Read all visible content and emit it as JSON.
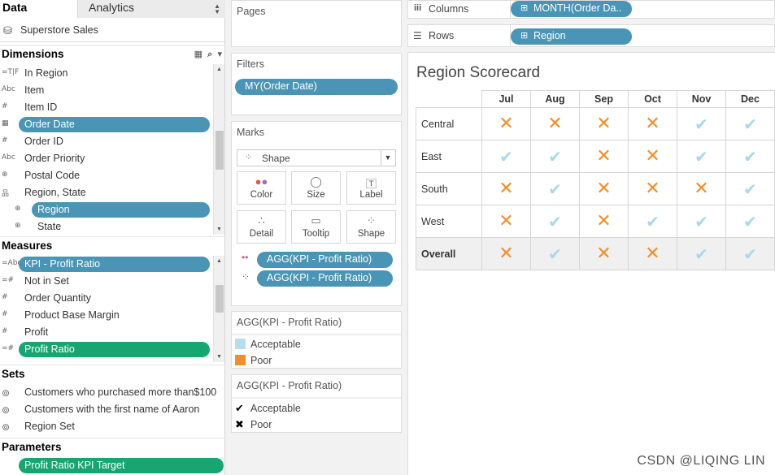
{
  "left": {
    "tab_data": "Data",
    "tab_analytics": "Analytics",
    "datasource": "Superstore Sales",
    "dimensions_title": "Dimensions",
    "dimensions": [
      {
        "label": "In Region",
        "icon": "=T|F"
      },
      {
        "label": "Item",
        "icon": "Abc"
      },
      {
        "label": "Item ID",
        "icon": "#"
      },
      {
        "label": "Order Date",
        "icon": "date"
      },
      {
        "label": "Order ID",
        "icon": "#"
      },
      {
        "label": "Order Priority",
        "icon": "Abc"
      },
      {
        "label": "Postal Code",
        "icon": "geo"
      },
      {
        "label": "Region, State",
        "icon": "hier"
      },
      {
        "label": "Region",
        "icon": "geo"
      },
      {
        "label": "State",
        "icon": "geo"
      }
    ],
    "measures_title": "Measures",
    "measures": [
      {
        "label": "KPI - Profit Ratio",
        "icon": "=Abc"
      },
      {
        "label": "Not in Set",
        "icon": "=#"
      },
      {
        "label": "Order Quantity",
        "icon": "#"
      },
      {
        "label": "Product Base Margin",
        "icon": "#"
      },
      {
        "label": "Profit",
        "icon": "#"
      },
      {
        "label": "Profit Ratio",
        "icon": "=#"
      }
    ],
    "sets_title": "Sets",
    "sets": [
      {
        "label": "Customers who purchased more than$100"
      },
      {
        "label": "Customers with the first name of Aaron"
      },
      {
        "label": "Region Set"
      }
    ],
    "parameters_title": "Parameters",
    "parameters": [
      {
        "label": "Profit Ratio KPI Target"
      }
    ]
  },
  "middle": {
    "pages_title": "Pages",
    "filters_title": "Filters",
    "filter_pill": "MY(Order Date)",
    "marks_title": "Marks",
    "mark_type": "Shape",
    "buttons": [
      "Color",
      "Size",
      "Label",
      "Detail",
      "Tooltip",
      "Shape"
    ],
    "mark_pills": [
      "AGG(KPI - Profit Ratio)",
      "AGG(KPI - Profit Ratio)"
    ],
    "legend1_title": "AGG(KPI - Profit Ratio)",
    "legend1_items": [
      {
        "label": "Acceptable",
        "color": "#b6dcee"
      },
      {
        "label": "Poor",
        "color": "#f28e2b"
      }
    ],
    "legend2_title": "AGG(KPI - Profit Ratio)",
    "legend2_items": [
      {
        "label": "Acceptable",
        "symbol": "✔"
      },
      {
        "label": "Poor",
        "symbol": "✖"
      }
    ]
  },
  "shelves": {
    "columns_label": "Columns",
    "columns_pill": "MONTH(Order Da..",
    "rows_label": "Rows",
    "rows_pill": "Region"
  },
  "viz": {
    "title": "Region Scorecard",
    "months": [
      "Jul",
      "Aug",
      "Sep",
      "Oct",
      "Nov",
      "Dec"
    ],
    "rows": [
      {
        "label": "Central",
        "values": [
          "Poor",
          "Poor",
          "Poor",
          "Poor",
          "Acceptable",
          "Acceptable"
        ]
      },
      {
        "label": "East",
        "values": [
          "Acceptable",
          "Acceptable",
          "Poor",
          "Poor",
          "Acceptable",
          "Acceptable"
        ]
      },
      {
        "label": "South",
        "values": [
          "Poor",
          "Acceptable",
          "Poor",
          "Poor",
          "Poor",
          "Acceptable"
        ]
      },
      {
        "label": "West",
        "values": [
          "Poor",
          "Acceptable",
          "Poor",
          "Acceptable",
          "Acceptable",
          "Acceptable"
        ]
      },
      {
        "label": "Overall",
        "values": [
          "Poor",
          "Acceptable",
          "Poor",
          "Poor",
          "Acceptable",
          "Acceptable"
        ]
      }
    ]
  },
  "watermark": "CSDN @LIQING LIN",
  "colors": {
    "pill_blue": "#4a95b5",
    "pill_green": "#17a672",
    "poor": "#f28e2b",
    "acceptable": "#a7d8ee"
  }
}
